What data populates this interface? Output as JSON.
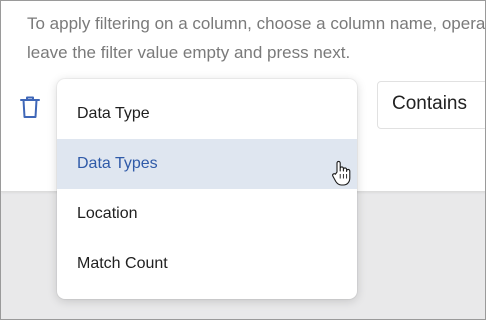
{
  "instructions": {
    "line1": "To apply filtering on a column, choose a column name, operator and enter a value. To remove filter,",
    "line2": "leave the filter value empty and press next."
  },
  "filter_row": {
    "delete_icon": "trash-icon",
    "operator_value": "Contains"
  },
  "column_dropdown": {
    "options": [
      {
        "label": "Data Type",
        "selected": false
      },
      {
        "label": "Data Types",
        "selected": true
      },
      {
        "label": "Location",
        "selected": false
      },
      {
        "label": "Match Count",
        "selected": false
      }
    ]
  },
  "colors": {
    "accent": "#3f67b8",
    "selected_bg": "#dfe6f0",
    "selected_text": "#2f5aa8",
    "page_bg": "#e9e9ea"
  },
  "cursor_icon": "hand-pointer-icon"
}
